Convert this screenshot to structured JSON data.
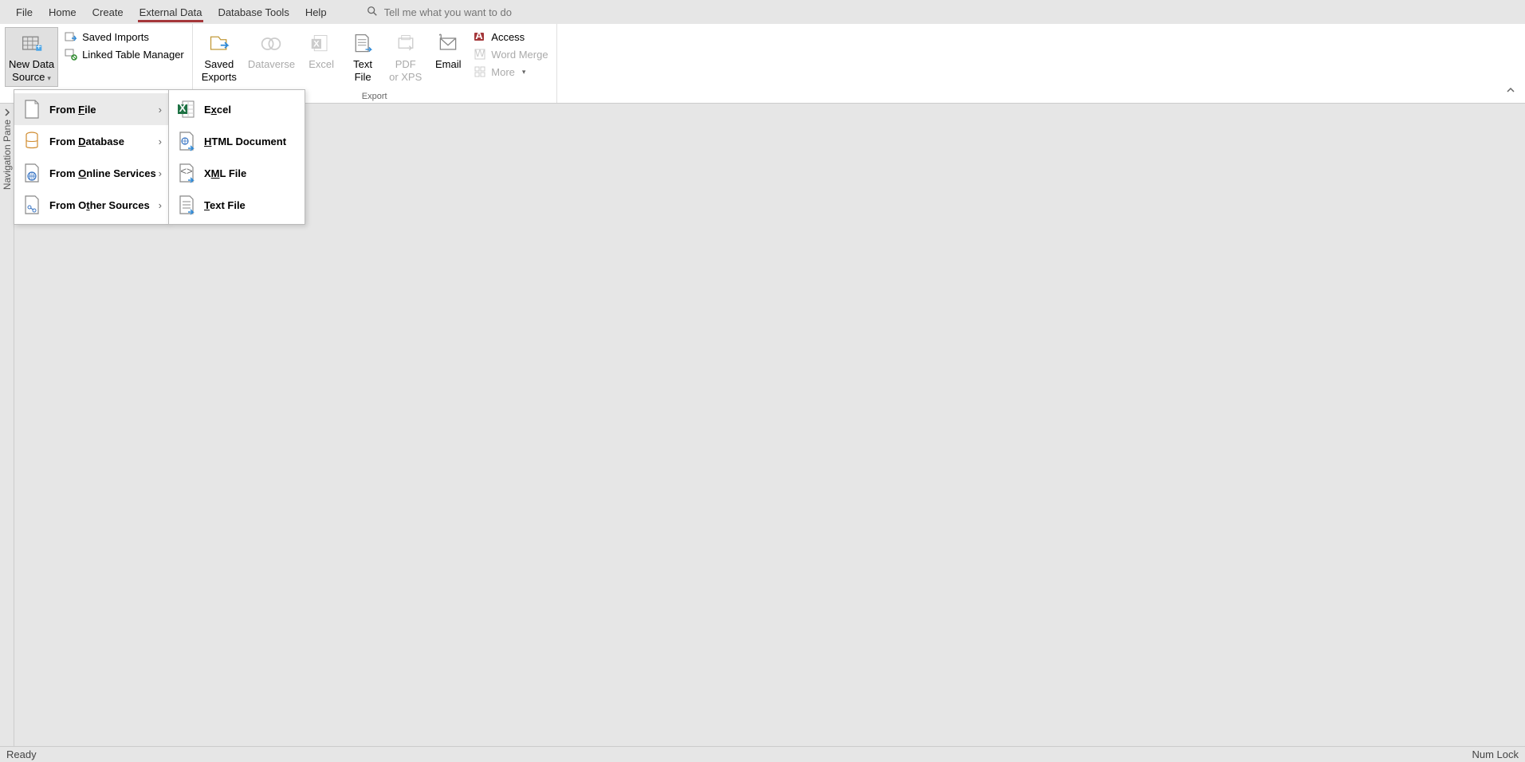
{
  "menu": {
    "file": "File",
    "home": "Home",
    "create": "Create",
    "external_data": "External Data",
    "database_tools": "Database Tools",
    "help": "Help"
  },
  "tell_me_placeholder": "Tell me what you want to do",
  "ribbon": {
    "new_data_source": "New Data\nSource",
    "saved_imports": "Saved Imports",
    "linked_table_manager": "Linked Table Manager",
    "saved_exports": "Saved\nExports",
    "dataverse": "Dataverse",
    "excel": "Excel",
    "text_file": "Text\nFile",
    "pdf_or_xps": "PDF\nor XPS",
    "email": "Email",
    "access": "Access",
    "word_merge": "Word Merge",
    "more": "More",
    "export_group": "Export"
  },
  "dropdown1": {
    "from_file": "From File",
    "from_database": "From Database",
    "from_online": "From Online Services",
    "from_other": "From Other Sources"
  },
  "dropdown2": {
    "excel": "Excel",
    "html": "HTML Document",
    "xml": "XML File",
    "text": "Text File"
  },
  "nav_pane": "Navigation Pane",
  "status": {
    "ready": "Ready",
    "num_lock": "Num Lock"
  }
}
